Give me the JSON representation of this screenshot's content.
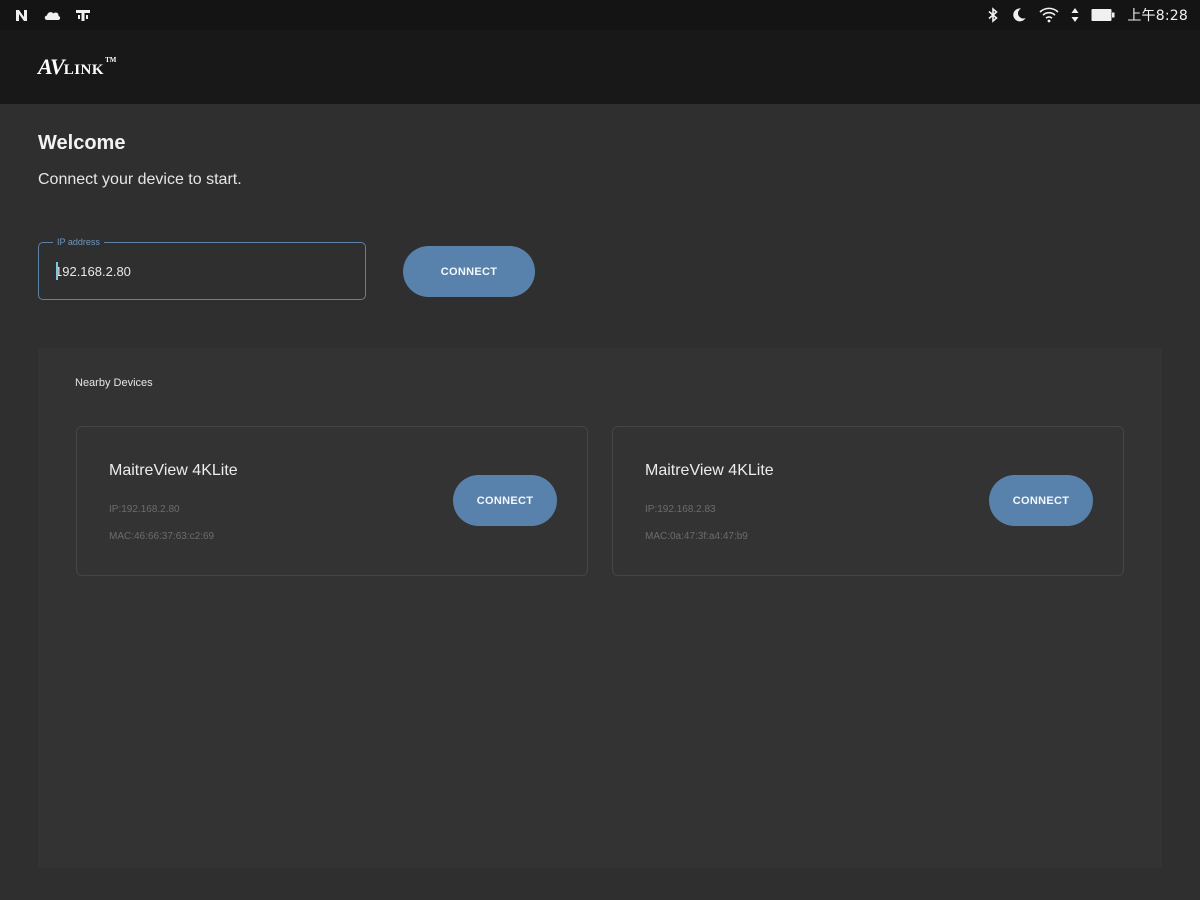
{
  "status_bar": {
    "left_icons": [
      "n-icon",
      "cloud-icon",
      "tv-icon"
    ],
    "right_icons": [
      "bluetooth-icon",
      "moon-icon",
      "wifi-icon",
      "battery-icon",
      "data-arrows-icon"
    ],
    "time": "上午8:28"
  },
  "app_bar": {
    "logo_main": "AV",
    "logo_sub": "LINK",
    "logo_tm": "TM"
  },
  "welcome": {
    "title": "Welcome",
    "subtitle": "Connect your device to start."
  },
  "ip_field": {
    "label": "IP address",
    "value": "192.168.2.80"
  },
  "connect_button": {
    "label": "CONNECT"
  },
  "nearby": {
    "title": "Nearby Devices",
    "devices": [
      {
        "name": "MaitreView 4KLite",
        "ip": "IP:192.168.2.80",
        "mac": "MAC:46:66:37:63:c2:69",
        "button_label": "CONNECT"
      },
      {
        "name": "MaitreView 4KLite",
        "ip": "IP:192.168.2.83",
        "mac": "MAC:0a:47:3f:a4:47:b9",
        "button_label": "CONNECT"
      }
    ]
  },
  "colors": {
    "background": "#2f2f2f",
    "app_bar": "#181818",
    "status_bar": "#141414",
    "accent": "#5882ac",
    "panel": "#333333"
  }
}
